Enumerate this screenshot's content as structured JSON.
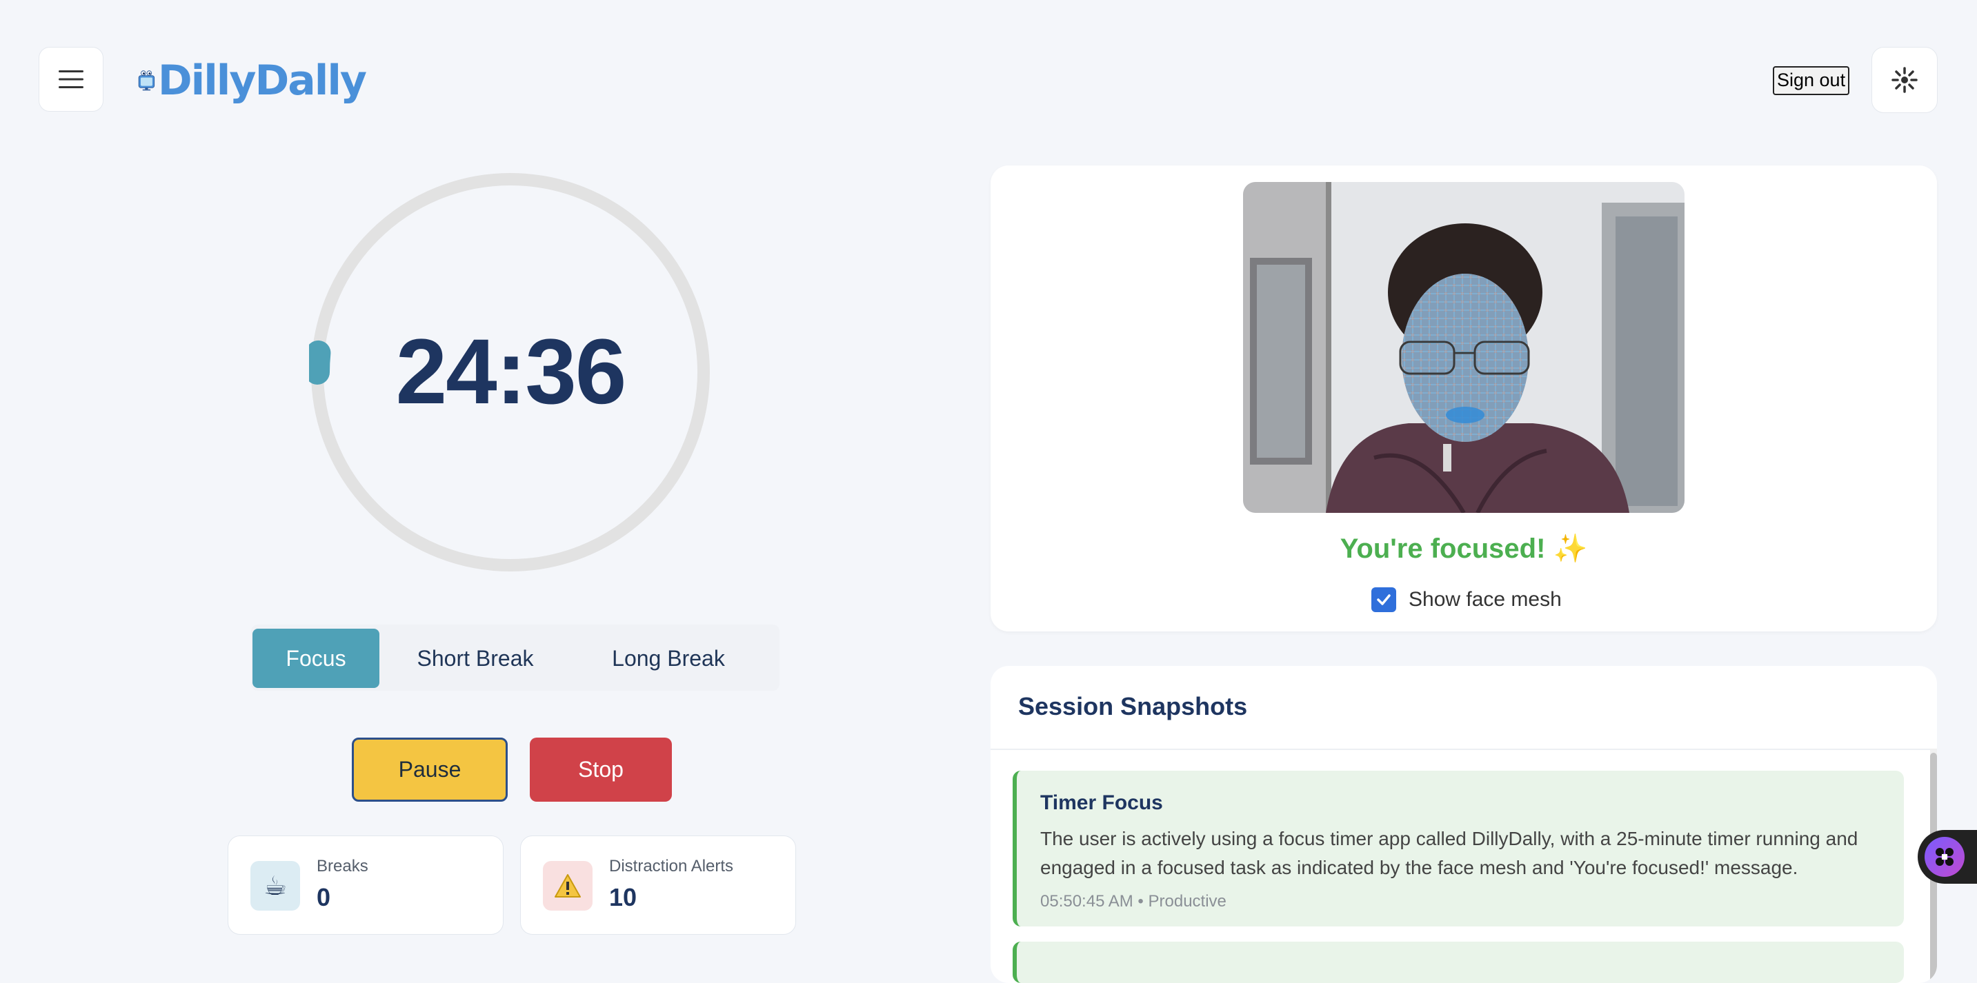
{
  "app": {
    "logo_text": "DillyDally",
    "sign_out_label": "Sign out",
    "menu_icon": "hamburger-menu-icon",
    "theme_icon": "sun-icon"
  },
  "timer": {
    "time": "24:36",
    "progress_fraction": 0.016,
    "accent_color": "#4fa1b7"
  },
  "modes": {
    "tabs": [
      {
        "label": "Focus",
        "active": true
      },
      {
        "label": "Short Break",
        "active": false
      },
      {
        "label": "Long Break",
        "active": false
      }
    ]
  },
  "controls": {
    "pause_label": "Pause",
    "stop_label": "Stop"
  },
  "stats": [
    {
      "label": "Breaks",
      "value": "0",
      "icon": "coffee-icon"
    },
    {
      "label": "Distraction Alerts",
      "value": "10",
      "icon": "warning-icon"
    }
  ],
  "camera": {
    "status": "You're focused! ✨",
    "show_mesh_label": "Show face mesh",
    "show_mesh_checked": true
  },
  "snapshots": {
    "title": "Session Snapshots",
    "items": [
      {
        "title": "Timer Focus",
        "text": "The user is actively using a focus timer app called DillyDally, with a 25-minute timer running and engaged in a focused task as indicated by the face mesh and 'You're focused!' message.",
        "meta": "05:50:45 AM • Productive"
      }
    ]
  }
}
